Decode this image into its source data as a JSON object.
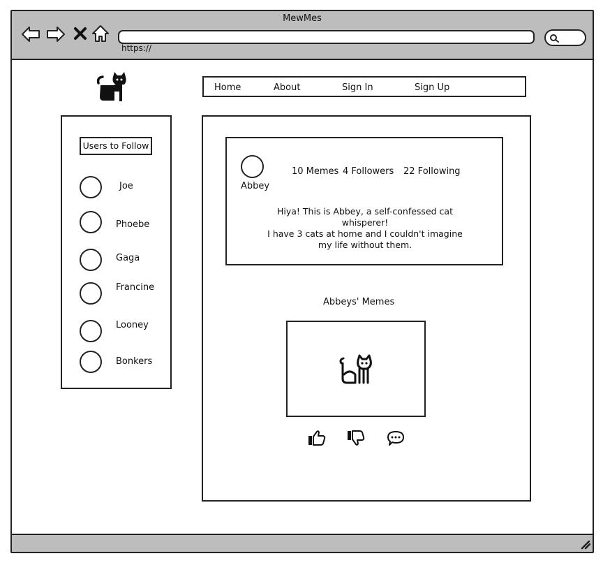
{
  "window": {
    "title": "MewMes",
    "address": "https://"
  },
  "nav": {
    "items": [
      "Home",
      "About",
      "Sign In",
      "Sign Up"
    ]
  },
  "sidebar": {
    "title": "Users to Follow",
    "users": [
      "Joe",
      "Phoebe",
      "Gaga",
      "Francine",
      "Looney",
      "Bonkers"
    ]
  },
  "profile": {
    "name": "Abbey",
    "memes": "10 Memes",
    "followers": "4 Followers",
    "following": "22 Following",
    "bio_lines": [
      "Hiya! This is Abbey, a self-confessed cat",
      "whisperer!",
      "I have 3 cats at home and I couldn't imagine",
      "my life without them."
    ]
  },
  "memes": {
    "heading": "Abbeys' Memes",
    "actions": [
      "thumbs-up-icon",
      "thumbs-down-icon",
      "comment-icon"
    ]
  },
  "icons": {
    "logo": "cat-logo-icon",
    "meme_image": "cat-outline-icon"
  }
}
